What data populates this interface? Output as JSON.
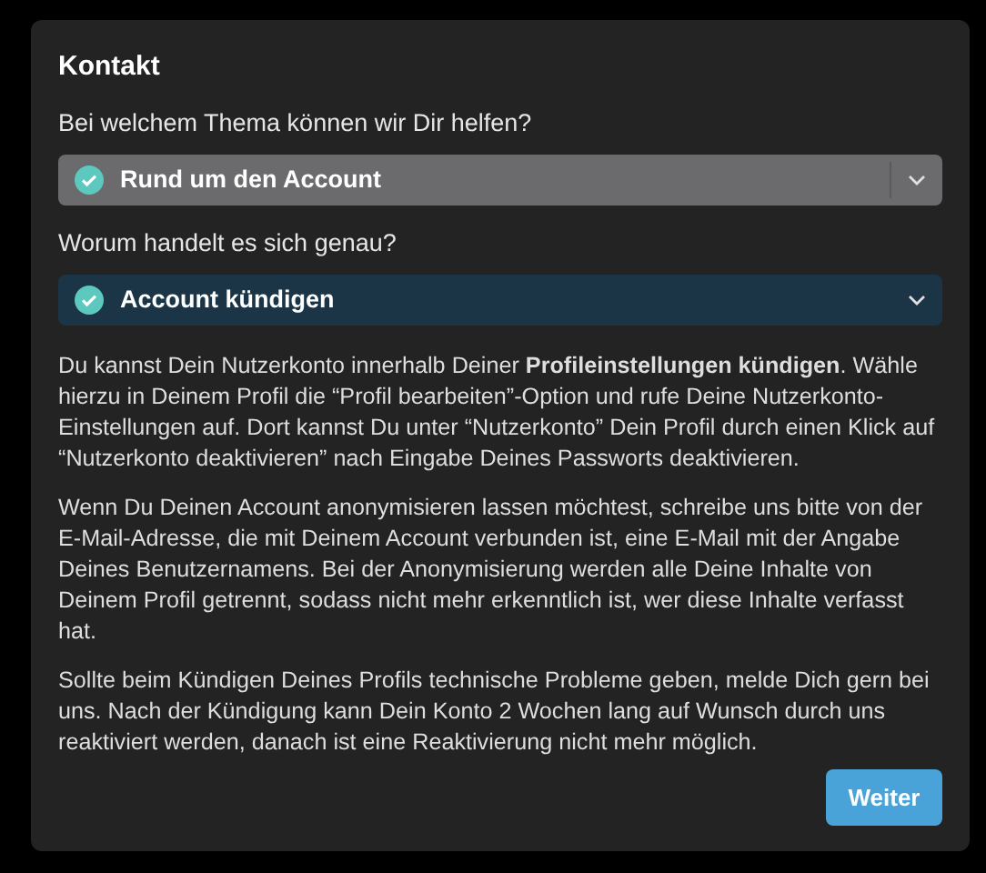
{
  "dialog": {
    "title": "Kontakt",
    "fields": [
      {
        "label": "Bei welchem Thema können wir Dir helfen?",
        "value": "Rund um den Account",
        "active": false
      },
      {
        "label": "Worum handelt es sich genau?",
        "value": "Account kündigen",
        "active": true
      }
    ],
    "paragraphs": [
      "Du kannst Dein Nutzerkonto innerhalb Deiner **Profileinstellungen kündigen**. Wähle hierzu in Deinem Profil die “Profil bearbeiten”-Option und rufe Deine Nutzerkonto-Einstellungen auf. Dort kannst Du unter “Nutzerkonto” Dein Profil durch einen Klick auf “Nutzerkonto deaktivieren” nach Eingabe Deines Passworts deaktivieren.",
      "Wenn Du Deinen Account anonymisieren lassen möchtest, schreibe uns bitte von der E-Mail-Adresse, die mit Deinem Account verbunden ist, eine E-Mail mit der Angabe Deines Benutzernamens. Bei der Anonymisierung werden alle Deine Inhalte von Deinem Profil getrennt, sodass nicht mehr erkenntlich ist, wer diese Inhalte verfasst hat.",
      "Sollte beim Kündigen Deines Profils technische Probleme geben, melde Dich gern bei uns. Nach der Kündigung kann Dein Konto 2 Wochen lang auf Wunsch durch uns reaktiviert werden, danach ist eine Reaktivierung nicht mehr möglich."
    ],
    "button": "Weiter"
  }
}
